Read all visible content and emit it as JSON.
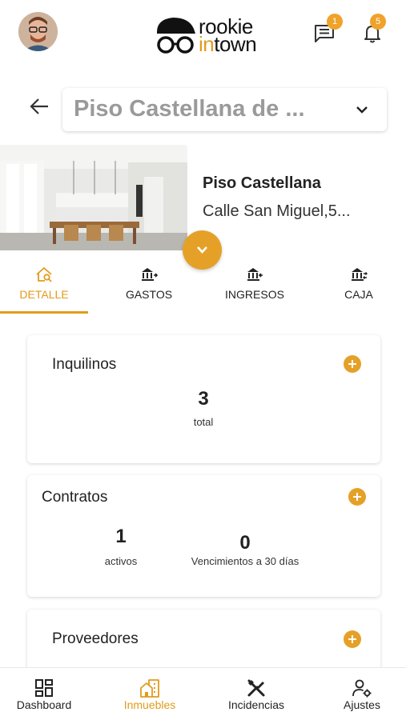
{
  "header": {
    "logo_line1": "rookie",
    "logo_line2_a": "in",
    "logo_line2_b": "town",
    "messages_badge": "1",
    "notifications_badge": "5"
  },
  "property": {
    "selector_value": "Piso Castellana de ...",
    "name": "Piso Castellana",
    "address": "Calle San Miguel,5..."
  },
  "tabs": [
    {
      "label": "DETALLE",
      "icon": "house-search-icon"
    },
    {
      "label": "GASTOS",
      "icon": "bank-out-icon"
    },
    {
      "label": "INGRESOS",
      "icon": "bank-in-icon"
    },
    {
      "label": "CAJA",
      "icon": "bank-exchange-icon"
    }
  ],
  "cards": {
    "inquilinos": {
      "title": "Inquilinos",
      "value": "3",
      "label": "total"
    },
    "contratos": {
      "title": "Contratos",
      "active_value": "1",
      "active_label": "activos",
      "expiring_value": "0",
      "expiring_label": "Vencimientos a 30 días"
    },
    "proveedores": {
      "title": "Proveedores"
    }
  },
  "bottom_nav": [
    {
      "label": "Dashboard",
      "icon": "dashboard-icon"
    },
    {
      "label": "Inmuebles",
      "icon": "buildings-icon"
    },
    {
      "label": "Incidencias",
      "icon": "tools-icon"
    },
    {
      "label": "Ajustes",
      "icon": "user-settings-icon"
    }
  ],
  "colors": {
    "accent": "#e29b1c",
    "badge": "#f0a32a"
  }
}
